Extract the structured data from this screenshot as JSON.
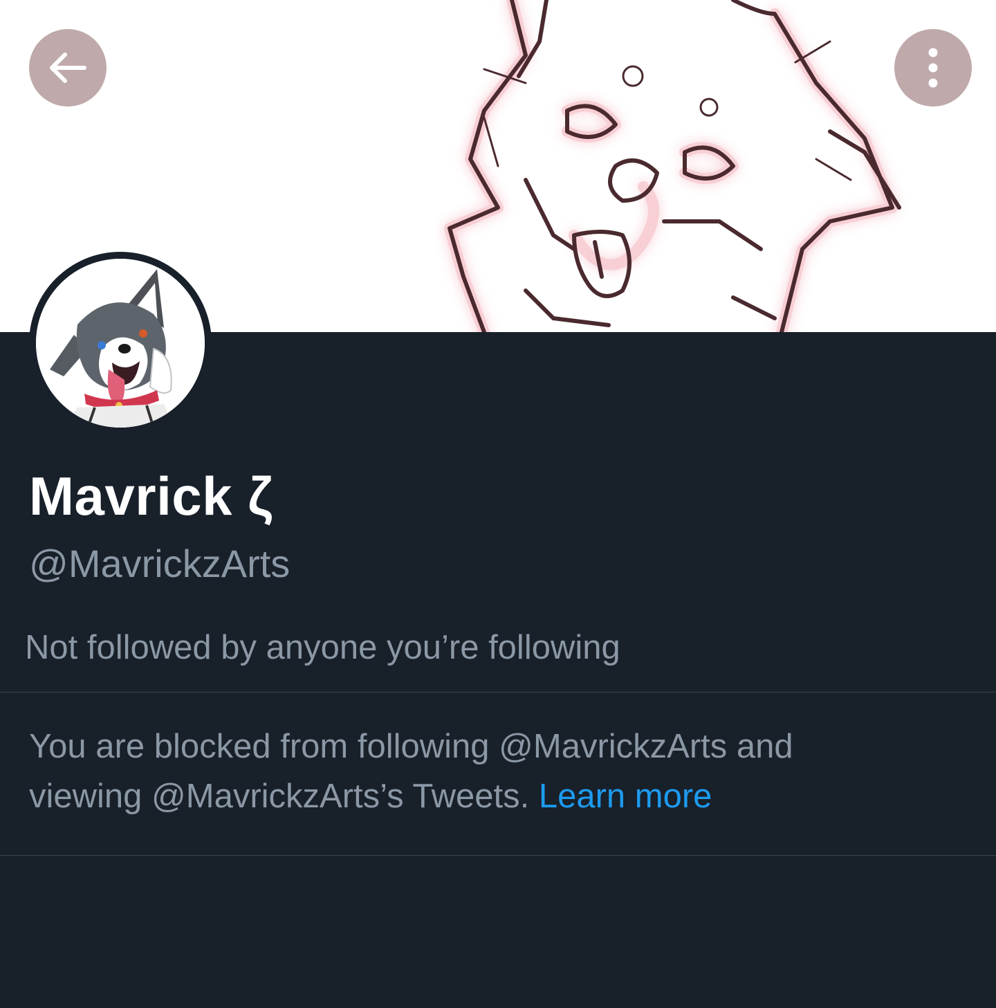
{
  "header": {
    "back_icon": "arrow-left-icon",
    "more_icon": "more-vertical-icon",
    "button_color": "#bfa9ab"
  },
  "profile": {
    "display_name": "Mavrick ζ",
    "handle": "@MavrickzArts",
    "followed_note": "Not followed by anyone you’re following"
  },
  "blocked_notice": {
    "line_1": "You are blocked from following @MavrickzArts and",
    "line_2": "viewing @MavrickzArts’s Tweets.",
    "learn_more_label": "Learn more"
  },
  "colors": {
    "background": "#18202a",
    "primary_text": "#ffffff",
    "secondary_text": "#8b98a5",
    "link": "#1d9bf0",
    "divider": "#38444d"
  }
}
